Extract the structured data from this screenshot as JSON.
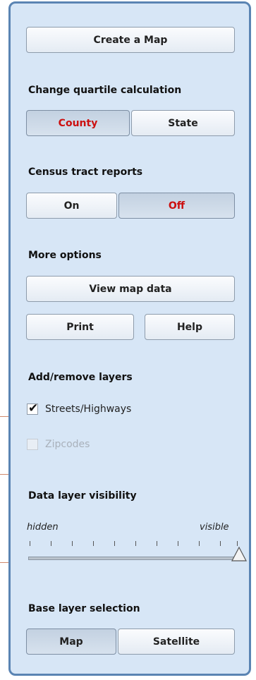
{
  "create_map_label": "Create a Map",
  "quartile": {
    "heading": "Change quartile calculation",
    "options": [
      "County",
      "State"
    ],
    "selected": "County"
  },
  "census": {
    "heading": "Census tract reports",
    "options": [
      "On",
      "Off"
    ],
    "selected": "Off"
  },
  "more_options": {
    "heading": "More options",
    "view_map_data_label": "View map data",
    "print_label": "Print",
    "help_label": "Help"
  },
  "layers": {
    "heading": "Add/remove layers",
    "items": [
      {
        "label": "Streets/Highways",
        "checked": true,
        "enabled": true
      },
      {
        "label": "Zipcodes",
        "checked": false,
        "enabled": false
      }
    ]
  },
  "visibility": {
    "heading": "Data layer visibility",
    "min_label": "hidden",
    "max_label": "visible",
    "value_fraction": 1.0
  },
  "base_layer": {
    "heading": "Base layer selection",
    "options": [
      "Map",
      "Satellite"
    ],
    "selected": "Map"
  },
  "colors": {
    "panel_bg": "#d7e6f6",
    "panel_border": "#5a84b3",
    "selected_text": "#cc1010"
  }
}
